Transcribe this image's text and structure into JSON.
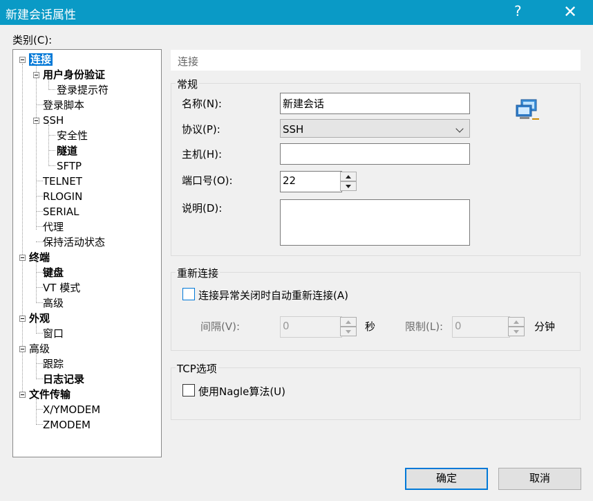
{
  "window": {
    "title": "新建会话属性",
    "help": "?",
    "close": "✕"
  },
  "category_label": "类别(C):",
  "tree": {
    "items": [
      {
        "label": "连接",
        "bold": true
      },
      {
        "label": "用户身份验证",
        "bold": true
      },
      {
        "label": "登录提示符",
        "bold": false
      },
      {
        "label": "登录脚本",
        "bold": false
      },
      {
        "label": "SSH",
        "bold": false
      },
      {
        "label": "安全性",
        "bold": false
      },
      {
        "label": "隧道",
        "bold": true
      },
      {
        "label": "SFTP",
        "bold": false
      },
      {
        "label": "TELNET",
        "bold": false
      },
      {
        "label": "RLOGIN",
        "bold": false
      },
      {
        "label": "SERIAL",
        "bold": false
      },
      {
        "label": "代理",
        "bold": false
      },
      {
        "label": "保持活动状态",
        "bold": false
      },
      {
        "label": "终端",
        "bold": true
      },
      {
        "label": "键盘",
        "bold": true
      },
      {
        "label": "VT 模式",
        "bold": false
      },
      {
        "label": "高级",
        "bold": false
      },
      {
        "label": "外观",
        "bold": true
      },
      {
        "label": "窗口",
        "bold": false
      },
      {
        "label": "高级",
        "bold": false
      },
      {
        "label": "跟踪",
        "bold": false
      },
      {
        "label": "日志记录",
        "bold": true
      },
      {
        "label": "文件传输",
        "bold": true
      },
      {
        "label": "X/YMODEM",
        "bold": false
      },
      {
        "label": "ZMODEM",
        "bold": false
      }
    ]
  },
  "panel": {
    "header": "连接",
    "general": {
      "title": "常规",
      "name_label": "名称(N):",
      "name_value": "新建会话",
      "protocol_label": "协议(P):",
      "protocol_value": "SSH",
      "host_label": "主机(H):",
      "host_value": "",
      "port_label": "端口号(O):",
      "port_value": "22",
      "desc_label": "说明(D):",
      "desc_value": ""
    },
    "reconnect": {
      "title": "重新连接",
      "checkbox_label": "连接异常关闭时自动重新连接(A)",
      "interval_label": "间隔(V):",
      "interval_value": "0",
      "interval_unit": "秒",
      "limit_label": "限制(L):",
      "limit_value": "0",
      "limit_unit": "分钟"
    },
    "tcp": {
      "title": "TCP选项",
      "nagle_label": "使用Nagle算法(U)"
    }
  },
  "buttons": {
    "ok": "确定",
    "cancel": "取消"
  },
  "colors": {
    "titlebar": "#0a9ac6",
    "selection": "#0078d7"
  }
}
